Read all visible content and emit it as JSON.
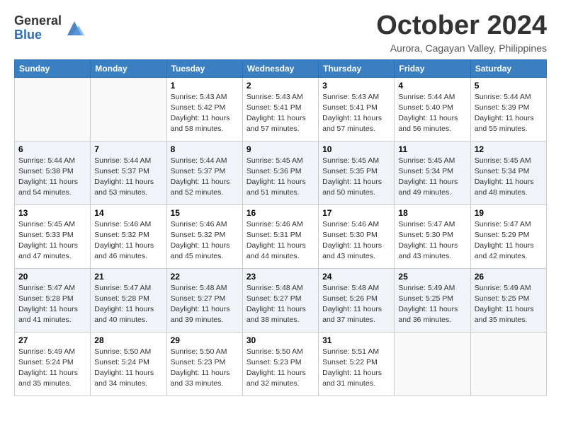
{
  "logo": {
    "general": "General",
    "blue": "Blue"
  },
  "title": "October 2024",
  "subtitle": "Aurora, Cagayan Valley, Philippines",
  "days_of_week": [
    "Sunday",
    "Monday",
    "Tuesday",
    "Wednesday",
    "Thursday",
    "Friday",
    "Saturday"
  ],
  "weeks": [
    {
      "shaded": false,
      "days": [
        {
          "num": "",
          "sunrise": "",
          "sunset": "",
          "daylight": ""
        },
        {
          "num": "",
          "sunrise": "",
          "sunset": "",
          "daylight": ""
        },
        {
          "num": "1",
          "sunrise": "Sunrise: 5:43 AM",
          "sunset": "Sunset: 5:42 PM",
          "daylight": "Daylight: 11 hours and 58 minutes."
        },
        {
          "num": "2",
          "sunrise": "Sunrise: 5:43 AM",
          "sunset": "Sunset: 5:41 PM",
          "daylight": "Daylight: 11 hours and 57 minutes."
        },
        {
          "num": "3",
          "sunrise": "Sunrise: 5:43 AM",
          "sunset": "Sunset: 5:41 PM",
          "daylight": "Daylight: 11 hours and 57 minutes."
        },
        {
          "num": "4",
          "sunrise": "Sunrise: 5:44 AM",
          "sunset": "Sunset: 5:40 PM",
          "daylight": "Daylight: 11 hours and 56 minutes."
        },
        {
          "num": "5",
          "sunrise": "Sunrise: 5:44 AM",
          "sunset": "Sunset: 5:39 PM",
          "daylight": "Daylight: 11 hours and 55 minutes."
        }
      ]
    },
    {
      "shaded": true,
      "days": [
        {
          "num": "6",
          "sunrise": "Sunrise: 5:44 AM",
          "sunset": "Sunset: 5:38 PM",
          "daylight": "Daylight: 11 hours and 54 minutes."
        },
        {
          "num": "7",
          "sunrise": "Sunrise: 5:44 AM",
          "sunset": "Sunset: 5:37 PM",
          "daylight": "Daylight: 11 hours and 53 minutes."
        },
        {
          "num": "8",
          "sunrise": "Sunrise: 5:44 AM",
          "sunset": "Sunset: 5:37 PM",
          "daylight": "Daylight: 11 hours and 52 minutes."
        },
        {
          "num": "9",
          "sunrise": "Sunrise: 5:45 AM",
          "sunset": "Sunset: 5:36 PM",
          "daylight": "Daylight: 11 hours and 51 minutes."
        },
        {
          "num": "10",
          "sunrise": "Sunrise: 5:45 AM",
          "sunset": "Sunset: 5:35 PM",
          "daylight": "Daylight: 11 hours and 50 minutes."
        },
        {
          "num": "11",
          "sunrise": "Sunrise: 5:45 AM",
          "sunset": "Sunset: 5:34 PM",
          "daylight": "Daylight: 11 hours and 49 minutes."
        },
        {
          "num": "12",
          "sunrise": "Sunrise: 5:45 AM",
          "sunset": "Sunset: 5:34 PM",
          "daylight": "Daylight: 11 hours and 48 minutes."
        }
      ]
    },
    {
      "shaded": false,
      "days": [
        {
          "num": "13",
          "sunrise": "Sunrise: 5:45 AM",
          "sunset": "Sunset: 5:33 PM",
          "daylight": "Daylight: 11 hours and 47 minutes."
        },
        {
          "num": "14",
          "sunrise": "Sunrise: 5:46 AM",
          "sunset": "Sunset: 5:32 PM",
          "daylight": "Daylight: 11 hours and 46 minutes."
        },
        {
          "num": "15",
          "sunrise": "Sunrise: 5:46 AM",
          "sunset": "Sunset: 5:32 PM",
          "daylight": "Daylight: 11 hours and 45 minutes."
        },
        {
          "num": "16",
          "sunrise": "Sunrise: 5:46 AM",
          "sunset": "Sunset: 5:31 PM",
          "daylight": "Daylight: 11 hours and 44 minutes."
        },
        {
          "num": "17",
          "sunrise": "Sunrise: 5:46 AM",
          "sunset": "Sunset: 5:30 PM",
          "daylight": "Daylight: 11 hours and 43 minutes."
        },
        {
          "num": "18",
          "sunrise": "Sunrise: 5:47 AM",
          "sunset": "Sunset: 5:30 PM",
          "daylight": "Daylight: 11 hours and 43 minutes."
        },
        {
          "num": "19",
          "sunrise": "Sunrise: 5:47 AM",
          "sunset": "Sunset: 5:29 PM",
          "daylight": "Daylight: 11 hours and 42 minutes."
        }
      ]
    },
    {
      "shaded": true,
      "days": [
        {
          "num": "20",
          "sunrise": "Sunrise: 5:47 AM",
          "sunset": "Sunset: 5:28 PM",
          "daylight": "Daylight: 11 hours and 41 minutes."
        },
        {
          "num": "21",
          "sunrise": "Sunrise: 5:47 AM",
          "sunset": "Sunset: 5:28 PM",
          "daylight": "Daylight: 11 hours and 40 minutes."
        },
        {
          "num": "22",
          "sunrise": "Sunrise: 5:48 AM",
          "sunset": "Sunset: 5:27 PM",
          "daylight": "Daylight: 11 hours and 39 minutes."
        },
        {
          "num": "23",
          "sunrise": "Sunrise: 5:48 AM",
          "sunset": "Sunset: 5:27 PM",
          "daylight": "Daylight: 11 hours and 38 minutes."
        },
        {
          "num": "24",
          "sunrise": "Sunrise: 5:48 AM",
          "sunset": "Sunset: 5:26 PM",
          "daylight": "Daylight: 11 hours and 37 minutes."
        },
        {
          "num": "25",
          "sunrise": "Sunrise: 5:49 AM",
          "sunset": "Sunset: 5:25 PM",
          "daylight": "Daylight: 11 hours and 36 minutes."
        },
        {
          "num": "26",
          "sunrise": "Sunrise: 5:49 AM",
          "sunset": "Sunset: 5:25 PM",
          "daylight": "Daylight: 11 hours and 35 minutes."
        }
      ]
    },
    {
      "shaded": false,
      "days": [
        {
          "num": "27",
          "sunrise": "Sunrise: 5:49 AM",
          "sunset": "Sunset: 5:24 PM",
          "daylight": "Daylight: 11 hours and 35 minutes."
        },
        {
          "num": "28",
          "sunrise": "Sunrise: 5:50 AM",
          "sunset": "Sunset: 5:24 PM",
          "daylight": "Daylight: 11 hours and 34 minutes."
        },
        {
          "num": "29",
          "sunrise": "Sunrise: 5:50 AM",
          "sunset": "Sunset: 5:23 PM",
          "daylight": "Daylight: 11 hours and 33 minutes."
        },
        {
          "num": "30",
          "sunrise": "Sunrise: 5:50 AM",
          "sunset": "Sunset: 5:23 PM",
          "daylight": "Daylight: 11 hours and 32 minutes."
        },
        {
          "num": "31",
          "sunrise": "Sunrise: 5:51 AM",
          "sunset": "Sunset: 5:22 PM",
          "daylight": "Daylight: 11 hours and 31 minutes."
        },
        {
          "num": "",
          "sunrise": "",
          "sunset": "",
          "daylight": ""
        },
        {
          "num": "",
          "sunrise": "",
          "sunset": "",
          "daylight": ""
        }
      ]
    }
  ]
}
